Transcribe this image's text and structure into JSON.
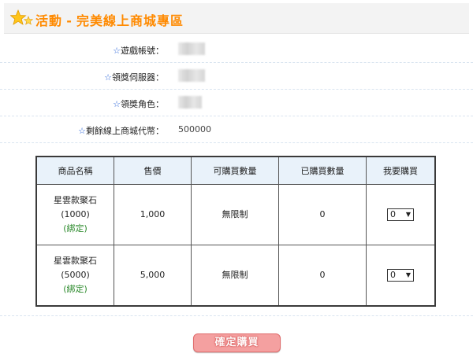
{
  "header": {
    "title_left": "活動",
    "title_sep": "-",
    "title_right": "完美線上商城專區"
  },
  "info": {
    "star": "☆",
    "rows": [
      {
        "label": "遊戲帳號：",
        "value": ""
      },
      {
        "label": "領獎伺服器：",
        "value": ""
      },
      {
        "label": "領獎角色：",
        "value": ""
      },
      {
        "label": "剩餘線上商城代幣：",
        "value": "500000"
      }
    ]
  },
  "table": {
    "headers": [
      "商品名稱",
      "售價",
      "可購買數量",
      "已購買數量",
      "我要購買"
    ],
    "rows": [
      {
        "name": "星雲款聚石",
        "qty_label": "(1000)",
        "bind": "(綁定)",
        "price": "1,000",
        "limit": "無限制",
        "bought": "0",
        "select": "0"
      },
      {
        "name": "星雲款聚石",
        "qty_label": "(5000)",
        "bind": "(綁定)",
        "price": "5,000",
        "limit": "無限制",
        "bought": "0",
        "select": "0"
      }
    ]
  },
  "confirm_button": "確定購買",
  "colors": {
    "title": "#ff8a00",
    "button": "#f4a0a0",
    "header_cell": "#e9f2fa",
    "bind_text": "#2c8a2c"
  }
}
